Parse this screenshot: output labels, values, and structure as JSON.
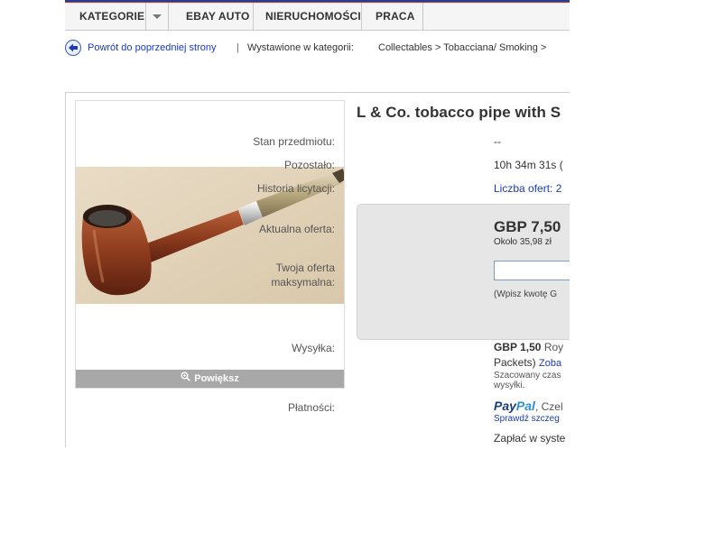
{
  "nav": {
    "items": [
      {
        "label": "KATEGORIE"
      },
      {
        "label": "EBAY AUTO"
      },
      {
        "label": "NIERUCHOMOŚCI"
      },
      {
        "label": "PRACA"
      }
    ]
  },
  "breadcrumb": {
    "back_label": "Powrót do poprzedniej strony",
    "separator": "|",
    "listed_in": "Wystawione w kategorii:",
    "category_path": "Collectables > Tobacciana/ Smoking >"
  },
  "image": {
    "enlarge_label": "Powiększ",
    "enlarge_icon": "magnifier-icon"
  },
  "item": {
    "title": "L & Co. tobacco pipe with S",
    "condition_label": "Stan przedmiotu:",
    "condition_value": "--",
    "time_left_label": "Pozostało:",
    "time_left_value": "10h 34m 31s (",
    "bid_history_label": "Historia licytacji:",
    "bid_history_value": "Liczba ofert: 2"
  },
  "bid": {
    "current_label": "Aktualna oferta:",
    "current_price": "GBP 7,50",
    "approx_price": "Około 35,98 zł",
    "max_bid_label_1": "Twoja oferta",
    "max_bid_label_2": "maksymalna:",
    "max_bid_value": "",
    "hint": "(Wpisz kwotę G"
  },
  "shipping": {
    "label": "Wysyłka:",
    "price": "GBP 1,50",
    "service": "Roy",
    "service_cont": "Packets)",
    "see_link": "Zoba",
    "estimate_line1": "Szacowany czas",
    "estimate_line2": "wysyłki."
  },
  "payments": {
    "label": "Płatności:",
    "paypal_pay": "Pay",
    "paypal_pal": "Pal",
    "paypal_rest": ", Czel",
    "check_link": "Sprawdź szczeg",
    "pay_system": "Zapłać w syste"
  },
  "colors": {
    "link": "#1a3cb0",
    "nav_border_top": "#2a3c8f",
    "bidbox_bg": "#e6e6e6"
  }
}
